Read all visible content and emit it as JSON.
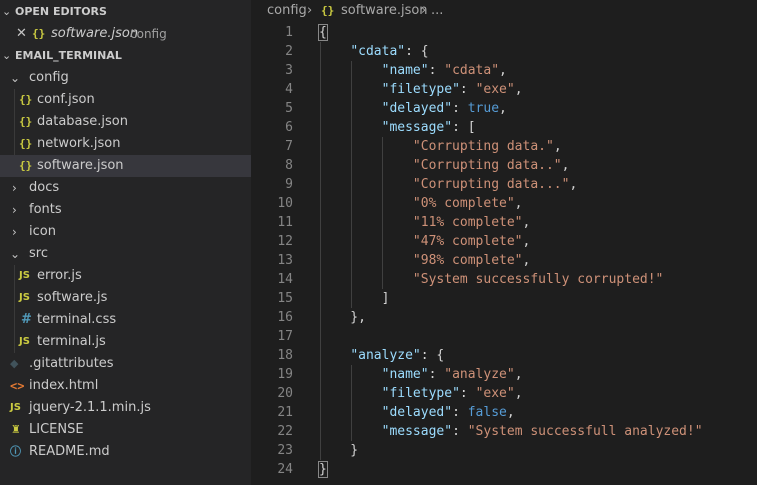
{
  "sidebar": {
    "open_editors": {
      "header": "OPEN EDITORS",
      "items": [
        {
          "name": "software.json",
          "description": "config",
          "icon": "json-icon"
        }
      ]
    },
    "workspace": {
      "header": "EMAIL_TERMINAL",
      "tree": [
        {
          "label": "config",
          "type": "folder",
          "expanded": true
        },
        {
          "label": "conf.json",
          "type": "json"
        },
        {
          "label": "database.json",
          "type": "json"
        },
        {
          "label": "network.json",
          "type": "json"
        },
        {
          "label": "software.json",
          "type": "json",
          "selected": true
        },
        {
          "label": "docs",
          "type": "folder",
          "expanded": false
        },
        {
          "label": "fonts",
          "type": "folder",
          "expanded": false
        },
        {
          "label": "icon",
          "type": "folder",
          "expanded": false
        },
        {
          "label": "src",
          "type": "folder",
          "expanded": true
        },
        {
          "label": "error.js",
          "type": "js"
        },
        {
          "label": "software.js",
          "type": "js"
        },
        {
          "label": "terminal.css",
          "type": "css"
        },
        {
          "label": "terminal.js",
          "type": "js"
        },
        {
          "label": ".gitattributes",
          "type": "git"
        },
        {
          "label": "index.html",
          "type": "html"
        },
        {
          "label": "jquery-2.1.1.min.js",
          "type": "js"
        },
        {
          "label": "LICENSE",
          "type": "license"
        },
        {
          "label": "README.md",
          "type": "info"
        }
      ]
    }
  },
  "icons": {
    "json": "{}",
    "js": "JS",
    "css": "#",
    "git": "◆",
    "html": "<>",
    "license": "♜",
    "info": "ⓘ",
    "chevron_down": "⌄",
    "chevron_right": "›",
    "close": "✕"
  },
  "breadcrumb": {
    "folder": "config",
    "sep": "›",
    "file": "software.json",
    "more": "..."
  },
  "editor": {
    "lines": [
      "{",
      "    \"cdata\": {",
      "        \"name\": \"cdata\",",
      "        \"filetype\": \"exe\",",
      "        \"delayed\": true,",
      "        \"message\": [",
      "            \"Corrupting data.\",",
      "            \"Corrupting data..\",",
      "            \"Corrupting data...\",",
      "            \"0% complete\",",
      "            \"11% complete\",",
      "            \"47% complete\",",
      "            \"98% complete\",",
      "            \"System successfully corrupted!\"",
      "        ]",
      "    },",
      "",
      "    \"analyze\": {",
      "        \"name\": \"analyze\",",
      "        \"filetype\": \"exe\",",
      "        \"delayed\": false,",
      "        \"message\": \"System successfull analyzed!\"",
      "    }",
      "}"
    ]
  },
  "colors": {
    "sidebar_bg": "#252526",
    "editor_bg": "#1e1e1e",
    "key": "#9cdcfe",
    "string": "#ce9178",
    "boolean": "#569cd6",
    "line_number": "#858585",
    "selection": "#37373d"
  }
}
